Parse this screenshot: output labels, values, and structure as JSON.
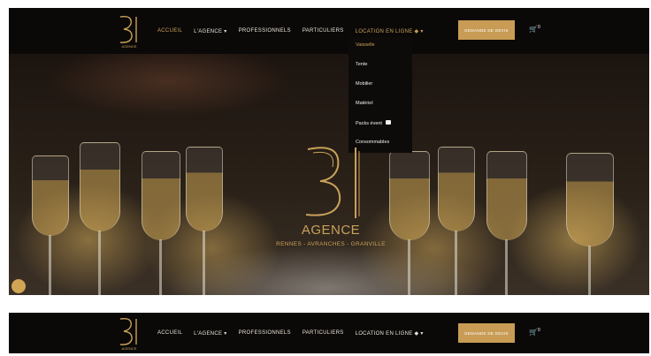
{
  "brand": {
    "logo_text": "AGENCE",
    "accent_color": "#c9a15a",
    "button_color": "#c89c55"
  },
  "nav": {
    "accueil": "ACCUEIL",
    "agence": "L'AGENCE ▾",
    "professionnels": "PROFESSIONNELS",
    "particuliers": "PARTICULIERS",
    "location": "LOCATION EN LIGNE",
    "cta": "DEMANDE DE DEVIS"
  },
  "dropdown": {
    "items": [
      "Vaisselle",
      "Tente",
      "Mobilier",
      "Matériel",
      "Packs évent",
      "Consommables"
    ]
  },
  "hero": {
    "title": "AGENCE",
    "subtitle": "RENNES - AVRANCHES - GRANVILLE"
  },
  "cart": {
    "count": "0"
  }
}
